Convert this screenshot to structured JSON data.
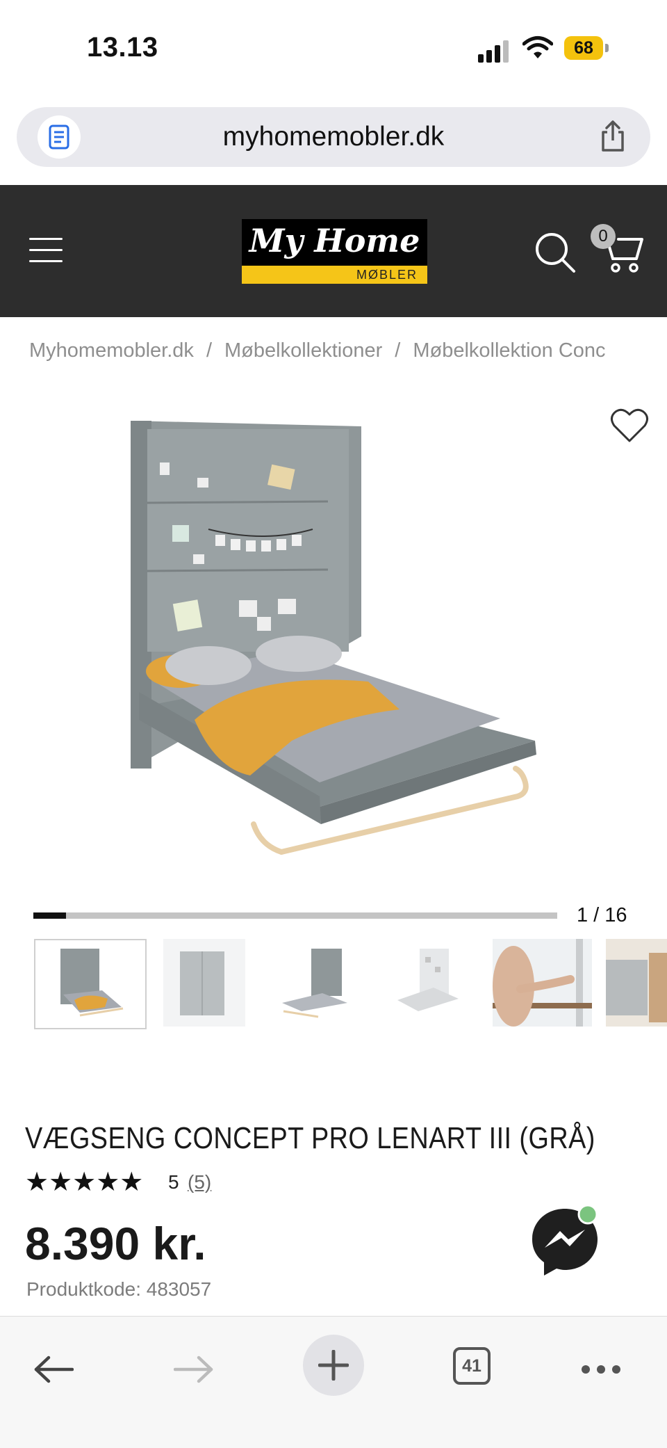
{
  "status_bar": {
    "time": "13.13",
    "battery": "68"
  },
  "browser": {
    "url": "myhomemobler.dk"
  },
  "site": {
    "logo": {
      "name": "My Home",
      "sub": "MØBLER"
    },
    "cart_count": "0"
  },
  "breadcrumb": [
    "Myhomemobler.dk",
    "Møbelkollektioner",
    "Møbelkollektion Conc"
  ],
  "breadcrumb_separator": "/",
  "gallery": {
    "counter": "1 / 16",
    "progress": 0.0625,
    "thumbnail_count": 6
  },
  "product": {
    "title": "VÆGSENG CONCEPT PRO LENART III (GRÅ)",
    "stars": "★★★★★",
    "rating": "5",
    "review_count": "(5)",
    "price": "8.390 kr.",
    "sku": "Produktkode: 483057"
  },
  "toolbar": {
    "tab_count": "41"
  },
  "colors": {
    "header": "#2d2d2d",
    "logo_accent": "#f5c518",
    "battery": "#f4c20d",
    "bed_blanket": "#e1a43c",
    "cabinet": "#8f9799"
  },
  "icons": [
    "reader-icon",
    "share-icon",
    "menu-icon",
    "search-icon",
    "cart-icon",
    "heart-icon",
    "messenger-icon",
    "back-arrow-icon",
    "forward-arrow-icon",
    "plus-icon",
    "tabs-icon",
    "more-icon"
  ]
}
